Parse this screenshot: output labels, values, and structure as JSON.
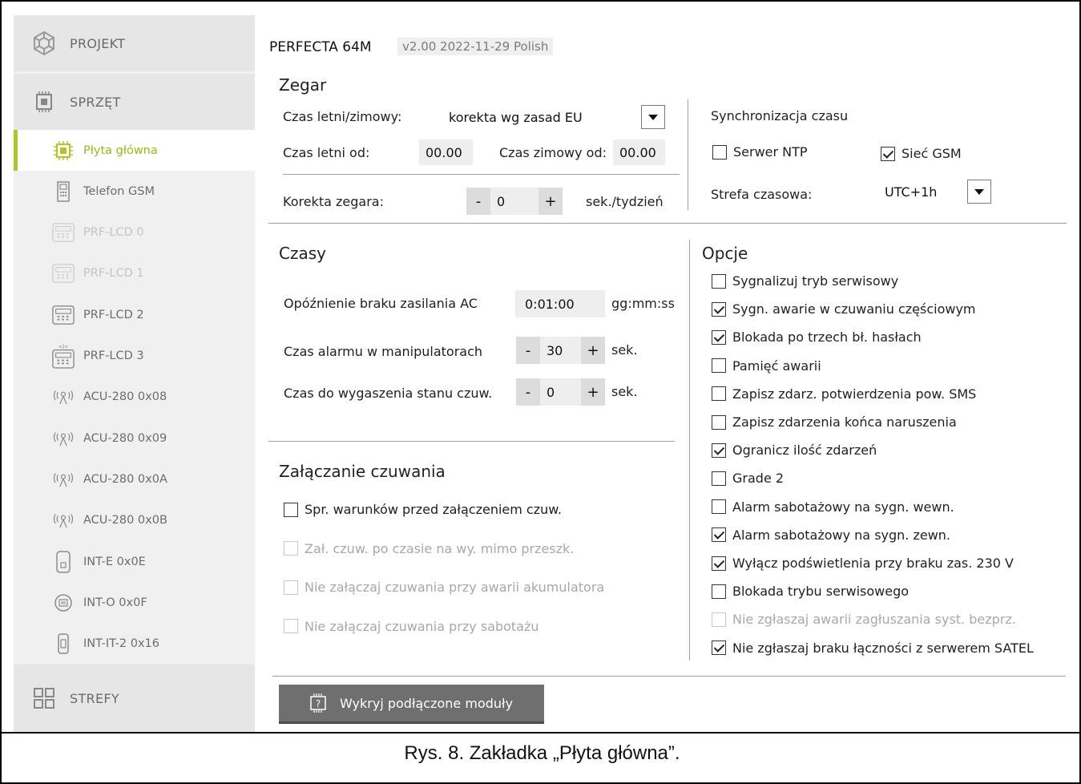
{
  "sidebar": {
    "sections": [
      {
        "label": "PROJEKT",
        "icon": "project-icon"
      },
      {
        "label": "SPRZĘT",
        "icon": "hardware-icon"
      },
      {
        "label": "STREFY",
        "icon": "zones-icon"
      }
    ],
    "items": [
      {
        "label": "Płyta główna",
        "icon": "mainboard-icon",
        "state": "active"
      },
      {
        "label": "Telefon GSM",
        "icon": "gsm-phone-icon",
        "state": "normal"
      },
      {
        "label": "PRF-LCD 0",
        "icon": "keypad-icon",
        "state": "disabled"
      },
      {
        "label": "PRF-LCD 1",
        "icon": "keypad-icon",
        "state": "disabled"
      },
      {
        "label": "PRF-LCD 2",
        "icon": "keypad-icon",
        "state": "normal"
      },
      {
        "label": "PRF-LCD 3",
        "icon": "wireless-keypad-icon",
        "state": "normal"
      },
      {
        "label": "ACU-280 0x08",
        "icon": "wireless-controller-icon",
        "state": "normal"
      },
      {
        "label": "ACU-280 0x09",
        "icon": "wireless-controller-icon",
        "state": "normal"
      },
      {
        "label": "ACU-280 0x0A",
        "icon": "wireless-controller-icon",
        "state": "normal"
      },
      {
        "label": "ACU-280 0x0B",
        "icon": "wireless-controller-icon",
        "state": "normal"
      },
      {
        "label": "INT-E 0x0E",
        "icon": "expander-icon",
        "state": "normal"
      },
      {
        "label": "INT-O 0x0F",
        "icon": "output-expander-icon",
        "state": "normal"
      },
      {
        "label": "INT-IT-2 0x16",
        "icon": "proximity-reader-icon",
        "state": "normal"
      }
    ]
  },
  "header": {
    "device": "PERFECTA 64M",
    "version": "v2.00 2022-11-29 Polish"
  },
  "clock": {
    "title": "Zegar",
    "dst_label": "Czas letni/zimowy:",
    "dst_value": "korekta wg zasad EU",
    "summer_label": "Czas letni od:",
    "summer_value": "00.00",
    "winter_label": "Czas zimowy od:",
    "winter_value": "00.00",
    "correction_label": "Korekta zegara:",
    "correction_minus": "-",
    "correction_value": "0",
    "correction_plus": "+",
    "correction_unit": "sek./tydzień"
  },
  "sync": {
    "title": "Synchronizacja czasu",
    "ntp_label": "Serwer NTP",
    "ntp_checked": false,
    "gsm_label": "Sieć GSM",
    "gsm_checked": true,
    "tz_label": "Strefa czasowa:",
    "tz_value": "UTC+1h"
  },
  "times": {
    "title": "Czasy",
    "ac_label": "Opóźnienie braku zasilania AC",
    "ac_value": "0:01:00",
    "ac_unit": "gg:mm:ss",
    "alarm_label": "Czas alarmu w manipulatorach",
    "alarm_minus": "-",
    "alarm_value": "30",
    "alarm_plus": "+",
    "alarm_unit": "sek.",
    "expire_label": "Czas do wygaszenia stanu czuw.",
    "expire_minus": "-",
    "expire_value": "0",
    "expire_plus": "+",
    "expire_unit": "sek."
  },
  "arming": {
    "title": "Załączanie czuwania",
    "options": [
      {
        "label": "Spr. warunków przed załączeniem czuw.",
        "checked": false,
        "disabled": false
      },
      {
        "label": "Zał. czuw. po czasie na wy. mimo przeszk.",
        "checked": false,
        "disabled": true
      },
      {
        "label": "Nie załączaj czuwania przy awarii akumulatora",
        "checked": false,
        "disabled": true
      },
      {
        "label": "Nie załączaj czuwania przy sabotażu",
        "checked": false,
        "disabled": true
      }
    ]
  },
  "options": {
    "title": "Opcje",
    "items": [
      {
        "label": "Sygnalizuj tryb serwisowy",
        "checked": false,
        "disabled": false
      },
      {
        "label": "Sygn. awarie w czuwaniu częściowym",
        "checked": true,
        "disabled": false
      },
      {
        "label": "Blokada po trzech bł. hasłach",
        "checked": true,
        "disabled": false
      },
      {
        "label": "Pamięć awarii",
        "checked": false,
        "disabled": false
      },
      {
        "label": "Zapisz zdarz. potwierdzenia pow. SMS",
        "checked": false,
        "disabled": false
      },
      {
        "label": "Zapisz zdarzenia końca naruszenia",
        "checked": false,
        "disabled": false
      },
      {
        "label": "Ogranicz ilość zdarzeń",
        "checked": true,
        "disabled": false
      },
      {
        "label": "Grade 2",
        "checked": false,
        "disabled": false
      },
      {
        "label": "Alarm sabotażowy na sygn. wewn.",
        "checked": false,
        "disabled": false
      },
      {
        "label": "Alarm sabotażowy na sygn. zewn.",
        "checked": true,
        "disabled": false
      },
      {
        "label": "Wyłącz podświetlenia przy braku zas. 230 V",
        "checked": true,
        "disabled": false
      },
      {
        "label": "Blokada trybu serwisowego",
        "checked": false,
        "disabled": false
      },
      {
        "label": "Nie zgłaszaj awarii zagłuszania syst. bezprz.",
        "checked": false,
        "disabled": true
      },
      {
        "label": "Nie zgłaszaj braku łączności z serwerem SATEL",
        "checked": true,
        "disabled": false
      }
    ]
  },
  "detect_button": {
    "label": "Wykryj podłączone moduły",
    "icon": "detect-modules-icon"
  },
  "caption": "Rys. 8. Zakładka „Płyta główna”.",
  "colors": {
    "accent": "#b2c726",
    "active_text": "#9fb515",
    "button": "#6f6f6f"
  }
}
